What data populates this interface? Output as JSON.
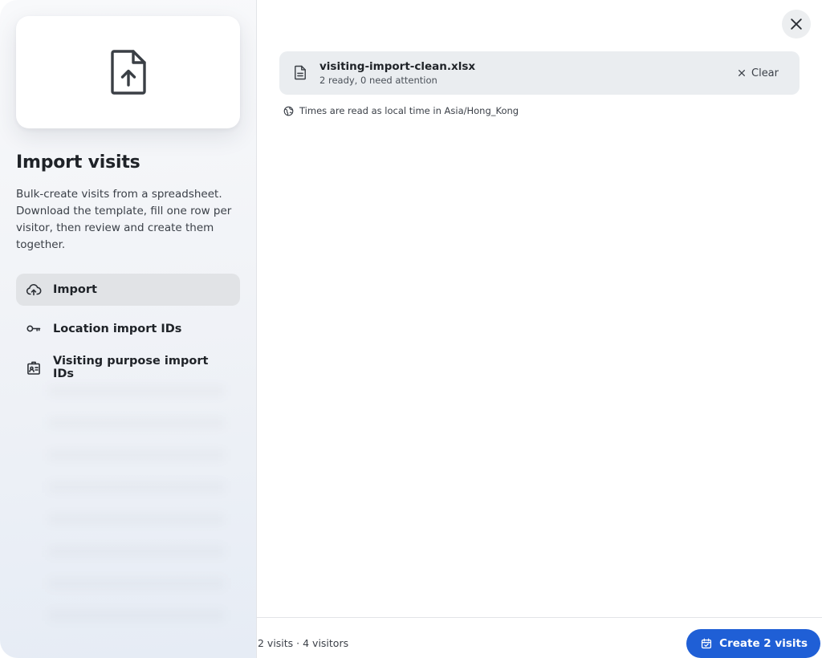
{
  "sidebar": {
    "hero_icon": "file-upload-icon",
    "title": "Import visits",
    "description": "Bulk-create visits from a spreadsheet. Download the template, fill one row per visitor, then review and create them together.",
    "nav": [
      {
        "label": "Import",
        "icon": "cloud-upload-icon",
        "active": true
      },
      {
        "label": "Location import IDs",
        "icon": "key-icon",
        "active": false
      },
      {
        "label": "Visiting purpose import IDs",
        "icon": "id-badge-icon",
        "active": false
      }
    ]
  },
  "main": {
    "close_icon": "close-icon",
    "file": {
      "icon": "document-icon",
      "name": "visiting-import-clean.xlsx",
      "status": "2 ready, 0 need attention",
      "clear_label": "Clear",
      "clear_icon": "x-icon"
    },
    "timezone_note": {
      "icon": "globe-icon",
      "text": "Times are read as local time in Asia/Hong_Kong"
    }
  },
  "footer": {
    "summary": "2 visits · 4 visitors",
    "create_label": "Create 2 visits",
    "create_icon": "calendar-check-icon"
  },
  "colors": {
    "primary": "#1f5fd6",
    "active_nav_bg": "#e1e3e6",
    "file_card_bg": "#eaedf0"
  }
}
